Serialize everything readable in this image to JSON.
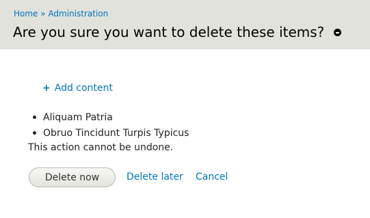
{
  "breadcrumb": {
    "home": "Home",
    "separator": "»",
    "admin": "Administration"
  },
  "page": {
    "title": "Are you sure you want to delete these items?"
  },
  "actions": {
    "add_content": "Add content",
    "add_icon": "+"
  },
  "items": [
    {
      "label": "Aliquam Patria"
    },
    {
      "label": "Obruo Tincidunt Turpis Typicus"
    }
  ],
  "warning": "This action cannot be undone.",
  "buttons": {
    "delete_now": "Delete now",
    "delete_later": "Delete later",
    "cancel": "Cancel"
  },
  "icons": {
    "shortcut": "remove-shortcut-icon"
  },
  "colors": {
    "link": "#0074bd",
    "header_bg": "#e1e2dc"
  }
}
